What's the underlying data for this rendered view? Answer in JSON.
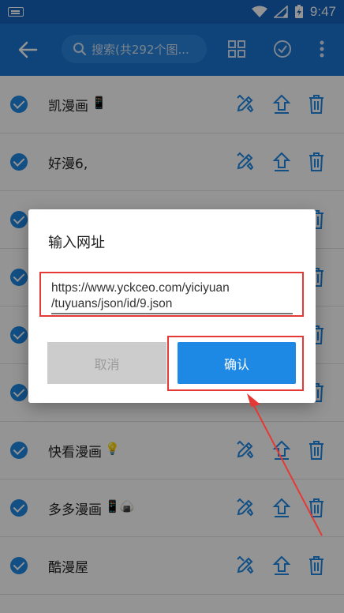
{
  "status_bar": {
    "time": "9:47"
  },
  "app_bar": {
    "search_placeholder": "搜索(共292个图..."
  },
  "list": [
    {
      "name": "凯漫画",
      "emoji": "📱"
    },
    {
      "name": "好漫6,",
      "emoji": ""
    },
    {
      "name": "",
      "emoji": ""
    },
    {
      "name": "",
      "emoji": ""
    },
    {
      "name": "",
      "emoji": ""
    },
    {
      "name": "",
      "emoji": ""
    },
    {
      "name": "快看漫画",
      "emoji": "💡"
    },
    {
      "name": "多多漫画",
      "emoji": "📱🍙"
    },
    {
      "name": "酷漫屋",
      "emoji": ""
    }
  ],
  "dialog": {
    "title": "输入网址",
    "url_line1": "https://www.yckceo.com/yiciyuan",
    "url_line2": "/tuyuans/json/id/9.json",
    "cancel_label": "取消",
    "confirm_label": "确认"
  },
  "colors": {
    "primary": "#1976d2",
    "accent": "#1e88e5",
    "highlight": "#e53935"
  }
}
